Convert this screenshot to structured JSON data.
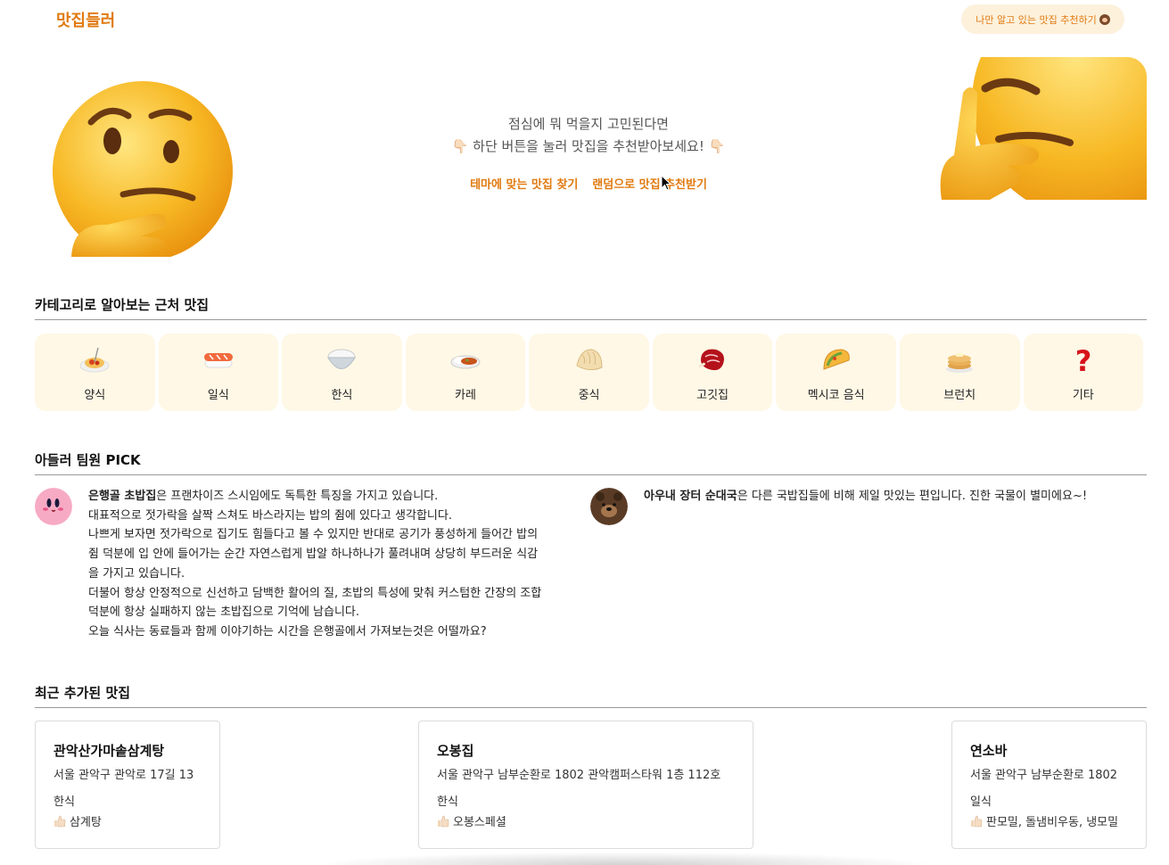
{
  "header": {
    "logo": "맛집들러",
    "recommend_button": "나만 알고 있는 맛집 추천하기"
  },
  "hero": {
    "line1": "점심에 뭐 먹을지 고민된다면",
    "line2": "👇🏻 하단 버튼을 눌러 맛집을 추천받아보세요! 👇🏻",
    "link_theme": "테마에 맞는 맛집 찾기",
    "link_random": "랜덤으로 맛집 추천받기"
  },
  "categories": {
    "title": "카테고리로 알아보는 근처 맛집",
    "items": [
      {
        "label": "양식",
        "icon": "spaghetti-icon"
      },
      {
        "label": "일식",
        "icon": "sushi-icon"
      },
      {
        "label": "한식",
        "icon": "rice-bowl-icon"
      },
      {
        "label": "카레",
        "icon": "curry-icon"
      },
      {
        "label": "중식",
        "icon": "dumpling-icon"
      },
      {
        "label": "고깃집",
        "icon": "meat-icon"
      },
      {
        "label": "멕시코 음식",
        "icon": "taco-icon"
      },
      {
        "label": "브런치",
        "icon": "pancake-icon"
      },
      {
        "label": "기타",
        "icon": "question-mark-icon"
      }
    ]
  },
  "picks": {
    "title": "아들러 팀원 PICK",
    "items": [
      {
        "name": "은행골 초밥집",
        "lines": [
          "은 프랜차이즈 스시임에도 독특한 특징을 가지고 있습니다.",
          "대표적으로 젓가락을 살짝 스쳐도 바스라지는 밥의 쥠에 있다고 생각합니다.",
          "나쁘게 보자면 젓가락으로 집기도 힘들다고 볼 수 있지만 반대로 공기가 풍성하게 들어간 밥의",
          "쥠 덕분에 입 안에 들어가는 순간 자연스럽게 밥알 하나하나가 풀려내며 상당히 부드러운 식감",
          "을 가지고 있습니다.",
          "더불어 항상 안정적으로 신선하고 담백한 활어의 질, 초밥의 특성에 맞춰 커스텀한 간장의 조합",
          "덕분에 항상 실패하지 않는 초밥집으로 기억에 남습니다.",
          "오늘 식사는 동료들과 함께 이야기하는 시간을 은행골에서 가져보는것은 어떨까요?"
        ]
      },
      {
        "name": "아우내 장터 순대국",
        "lines": [
          "은 다른 국밥집들에 비해 제일 맛있는 편입니다. 진한 국물이 별미에요~!"
        ]
      }
    ]
  },
  "recent": {
    "title": "최근 추가된 맛집",
    "items": [
      {
        "name": "관악산가마솥삼계탕",
        "address": "서울 관악구 관악로 17길 13",
        "category": "한식",
        "menu": "삼계탕"
      },
      {
        "name": "오봉집",
        "address": "서울 관악구 남부순환로 1802 관악캠퍼스타워 1층 112호",
        "category": "한식",
        "menu": "오봉스페셜"
      },
      {
        "name": "연소바",
        "address": "서울 관악구 남부순환로 1802",
        "category": "일식",
        "menu": "판모밀, 돌냄비우동, 냉모밀"
      }
    ]
  },
  "colors": {
    "accent": "#e07a10",
    "card_bg": "#fff8e6",
    "button_bg": "#fdf1dc"
  }
}
